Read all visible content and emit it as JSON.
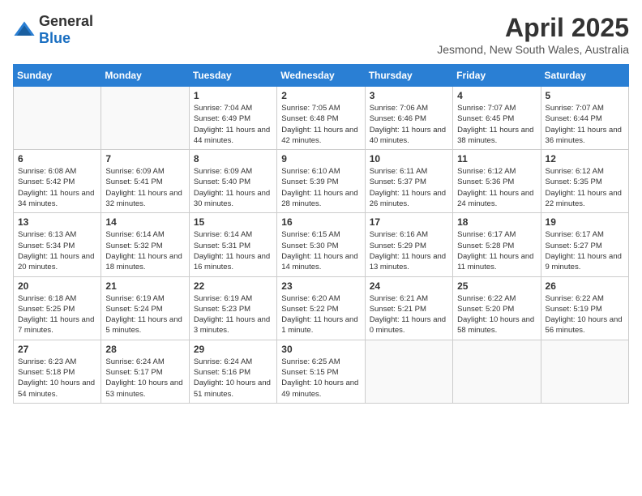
{
  "header": {
    "logo_general": "General",
    "logo_blue": "Blue",
    "month_year": "April 2025",
    "location": "Jesmond, New South Wales, Australia"
  },
  "calendar": {
    "days_of_week": [
      "Sunday",
      "Monday",
      "Tuesday",
      "Wednesday",
      "Thursday",
      "Friday",
      "Saturday"
    ],
    "weeks": [
      [
        {
          "day": "",
          "info": ""
        },
        {
          "day": "",
          "info": ""
        },
        {
          "day": "1",
          "info": "Sunrise: 7:04 AM\nSunset: 6:49 PM\nDaylight: 11 hours and 44 minutes."
        },
        {
          "day": "2",
          "info": "Sunrise: 7:05 AM\nSunset: 6:48 PM\nDaylight: 11 hours and 42 minutes."
        },
        {
          "day": "3",
          "info": "Sunrise: 7:06 AM\nSunset: 6:46 PM\nDaylight: 11 hours and 40 minutes."
        },
        {
          "day": "4",
          "info": "Sunrise: 7:07 AM\nSunset: 6:45 PM\nDaylight: 11 hours and 38 minutes."
        },
        {
          "day": "5",
          "info": "Sunrise: 7:07 AM\nSunset: 6:44 PM\nDaylight: 11 hours and 36 minutes."
        }
      ],
      [
        {
          "day": "6",
          "info": "Sunrise: 6:08 AM\nSunset: 5:42 PM\nDaylight: 11 hours and 34 minutes."
        },
        {
          "day": "7",
          "info": "Sunrise: 6:09 AM\nSunset: 5:41 PM\nDaylight: 11 hours and 32 minutes."
        },
        {
          "day": "8",
          "info": "Sunrise: 6:09 AM\nSunset: 5:40 PM\nDaylight: 11 hours and 30 minutes."
        },
        {
          "day": "9",
          "info": "Sunrise: 6:10 AM\nSunset: 5:39 PM\nDaylight: 11 hours and 28 minutes."
        },
        {
          "day": "10",
          "info": "Sunrise: 6:11 AM\nSunset: 5:37 PM\nDaylight: 11 hours and 26 minutes."
        },
        {
          "day": "11",
          "info": "Sunrise: 6:12 AM\nSunset: 5:36 PM\nDaylight: 11 hours and 24 minutes."
        },
        {
          "day": "12",
          "info": "Sunrise: 6:12 AM\nSunset: 5:35 PM\nDaylight: 11 hours and 22 minutes."
        }
      ],
      [
        {
          "day": "13",
          "info": "Sunrise: 6:13 AM\nSunset: 5:34 PM\nDaylight: 11 hours and 20 minutes."
        },
        {
          "day": "14",
          "info": "Sunrise: 6:14 AM\nSunset: 5:32 PM\nDaylight: 11 hours and 18 minutes."
        },
        {
          "day": "15",
          "info": "Sunrise: 6:14 AM\nSunset: 5:31 PM\nDaylight: 11 hours and 16 minutes."
        },
        {
          "day": "16",
          "info": "Sunrise: 6:15 AM\nSunset: 5:30 PM\nDaylight: 11 hours and 14 minutes."
        },
        {
          "day": "17",
          "info": "Sunrise: 6:16 AM\nSunset: 5:29 PM\nDaylight: 11 hours and 13 minutes."
        },
        {
          "day": "18",
          "info": "Sunrise: 6:17 AM\nSunset: 5:28 PM\nDaylight: 11 hours and 11 minutes."
        },
        {
          "day": "19",
          "info": "Sunrise: 6:17 AM\nSunset: 5:27 PM\nDaylight: 11 hours and 9 minutes."
        }
      ],
      [
        {
          "day": "20",
          "info": "Sunrise: 6:18 AM\nSunset: 5:25 PM\nDaylight: 11 hours and 7 minutes."
        },
        {
          "day": "21",
          "info": "Sunrise: 6:19 AM\nSunset: 5:24 PM\nDaylight: 11 hours and 5 minutes."
        },
        {
          "day": "22",
          "info": "Sunrise: 6:19 AM\nSunset: 5:23 PM\nDaylight: 11 hours and 3 minutes."
        },
        {
          "day": "23",
          "info": "Sunrise: 6:20 AM\nSunset: 5:22 PM\nDaylight: 11 hours and 1 minute."
        },
        {
          "day": "24",
          "info": "Sunrise: 6:21 AM\nSunset: 5:21 PM\nDaylight: 11 hours and 0 minutes."
        },
        {
          "day": "25",
          "info": "Sunrise: 6:22 AM\nSunset: 5:20 PM\nDaylight: 10 hours and 58 minutes."
        },
        {
          "day": "26",
          "info": "Sunrise: 6:22 AM\nSunset: 5:19 PM\nDaylight: 10 hours and 56 minutes."
        }
      ],
      [
        {
          "day": "27",
          "info": "Sunrise: 6:23 AM\nSunset: 5:18 PM\nDaylight: 10 hours and 54 minutes."
        },
        {
          "day": "28",
          "info": "Sunrise: 6:24 AM\nSunset: 5:17 PM\nDaylight: 10 hours and 53 minutes."
        },
        {
          "day": "29",
          "info": "Sunrise: 6:24 AM\nSunset: 5:16 PM\nDaylight: 10 hours and 51 minutes."
        },
        {
          "day": "30",
          "info": "Sunrise: 6:25 AM\nSunset: 5:15 PM\nDaylight: 10 hours and 49 minutes."
        },
        {
          "day": "",
          "info": ""
        },
        {
          "day": "",
          "info": ""
        },
        {
          "day": "",
          "info": ""
        }
      ]
    ]
  }
}
